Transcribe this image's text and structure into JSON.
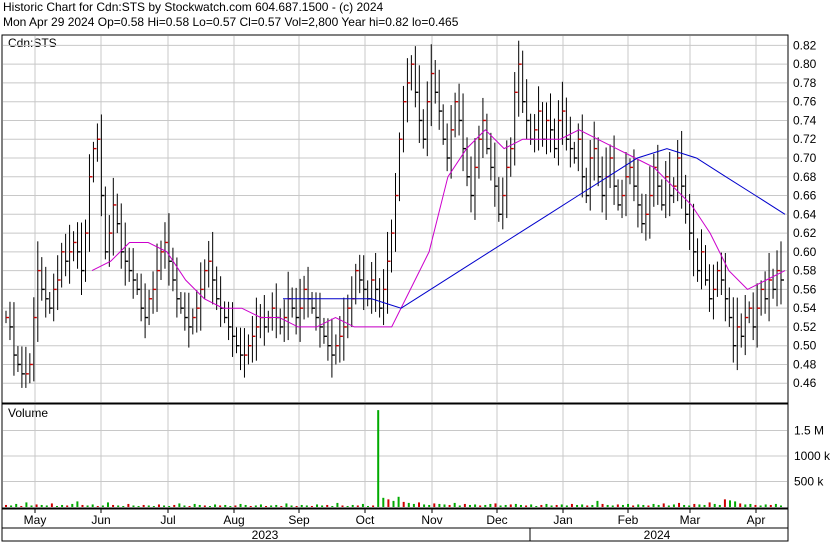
{
  "header": {
    "line1": "Historic Chart for Cdn:STS by Stockwatch.com 604.687.1500 - (c) 2024",
    "line2": "Mon Apr 29 2024  Op=0.58  Hi=0.58  Lo=0.57  Cl=0.57  Vol=2,800  Year hi=0.82  lo=0.465"
  },
  "price_panel": {
    "symbol_label": "Cdn:STS"
  },
  "volume_panel": {
    "label": "Volume"
  },
  "colors": {
    "up_tick": "#cc0000",
    "bar": "#000000",
    "ma_short": "#cc00cc",
    "ma_long": "#0000cc",
    "volume_up": "#00aa00",
    "volume_down": "#cc0000",
    "grid": "#c8c8c8"
  },
  "chart_data": [
    {
      "type": "ohlc",
      "title": "Cdn:STS",
      "ylim": [
        0.44,
        0.83
      ],
      "yticks": [
        "0.82",
        "0.80",
        "0.78",
        "0.76",
        "0.74",
        "0.72",
        "0.70",
        "0.68",
        "0.66",
        "0.64",
        "0.62",
        "0.60",
        "0.58",
        "0.56",
        "0.54",
        "0.52",
        "0.50",
        "0.48",
        "0.46"
      ],
      "xlabels": [
        "May",
        "Jun",
        "Jul",
        "Aug",
        "Sep",
        "Oct",
        "Nov",
        "Dec",
        "Jan",
        "Feb",
        "Mar",
        "Apr"
      ],
      "year_labels": [
        "2023",
        "2024"
      ],
      "grid": true,
      "series": [
        {
          "kind": "close",
          "values": [
            0.53,
            0.52,
            0.49,
            0.48,
            0.47,
            0.47,
            0.48,
            0.53,
            0.58,
            0.56,
            0.55,
            0.54,
            0.56,
            0.57,
            0.6,
            0.59,
            0.6,
            0.61,
            0.6,
            0.58,
            0.62,
            0.68,
            0.71,
            0.72,
            0.66,
            0.6,
            0.62,
            0.65,
            0.63,
            0.6,
            0.59,
            0.58,
            0.57,
            0.56,
            0.54,
            0.53,
            0.55,
            0.56,
            0.58,
            0.6,
            0.61,
            0.59,
            0.57,
            0.55,
            0.54,
            0.53,
            0.52,
            0.53,
            0.54,
            0.56,
            0.58,
            0.59,
            0.57,
            0.55,
            0.54,
            0.53,
            0.52,
            0.51,
            0.5,
            0.49,
            0.49,
            0.5,
            0.51,
            0.52,
            0.53,
            0.52,
            0.53,
            0.54,
            0.53,
            0.52,
            0.53,
            0.55,
            0.54,
            0.53,
            0.54,
            0.56,
            0.55,
            0.54,
            0.53,
            0.52,
            0.51,
            0.5,
            0.49,
            0.5,
            0.51,
            0.52,
            0.54,
            0.55,
            0.58,
            0.57,
            0.56,
            0.55,
            0.57,
            0.56,
            0.54,
            0.56,
            0.59,
            0.62,
            0.66,
            0.72,
            0.76,
            0.78,
            0.8,
            0.77,
            0.74,
            0.72,
            0.76,
            0.79,
            0.77,
            0.75,
            0.72,
            0.7,
            0.73,
            0.76,
            0.74,
            0.71,
            0.68,
            0.66,
            0.69,
            0.72,
            0.74,
            0.71,
            0.69,
            0.67,
            0.64,
            0.66,
            0.69,
            0.71,
            0.77,
            0.8,
            0.76,
            0.74,
            0.72,
            0.73,
            0.75,
            0.72,
            0.74,
            0.73,
            0.71,
            0.74,
            0.75,
            0.72,
            0.71,
            0.7,
            0.72,
            0.68,
            0.66,
            0.7,
            0.71,
            0.68,
            0.66,
            0.68,
            0.7,
            0.67,
            0.65,
            0.66,
            0.68,
            0.69,
            0.67,
            0.65,
            0.63,
            0.64,
            0.66,
            0.69,
            0.67,
            0.65,
            0.68,
            0.66,
            0.67,
            0.7,
            0.67,
            0.64,
            0.62,
            0.6,
            0.58,
            0.6,
            0.57,
            0.55,
            0.56,
            0.58,
            0.57,
            0.55,
            0.53,
            0.5,
            0.52,
            0.51,
            0.53,
            0.54,
            0.52,
            0.54,
            0.56,
            0.55,
            0.57,
            0.56,
            0.58,
            0.57
          ],
          "note": "daily closes, May 2023 to Apr 29 2024"
        }
      ],
      "moving_averages": [
        {
          "label": "short MA (magenta)",
          "values": [
            0.58,
            0.59,
            0.61,
            0.61,
            0.6,
            0.57,
            0.55,
            0.54,
            0.54,
            0.53,
            0.53,
            0.52,
            0.52,
            0.53,
            0.52,
            0.52,
            0.52,
            0.56,
            0.6,
            0.68,
            0.71,
            0.73,
            0.71,
            0.72,
            0.72,
            0.72,
            0.73,
            0.72,
            0.71,
            0.7,
            0.69,
            0.67,
            0.65,
            0.62,
            0.58,
            0.56,
            0.57,
            0.58
          ]
        },
        {
          "label": "long MA (blue)",
          "values": [
            0.55,
            0.55,
            0.55,
            0.55,
            0.54,
            0.56,
            0.58,
            0.6,
            0.62,
            0.64,
            0.66,
            0.68,
            0.7,
            0.71,
            0.7,
            0.68,
            0.66,
            0.64
          ]
        }
      ]
    },
    {
      "type": "bar",
      "title": "Volume",
      "yticks": [
        "1.5 M",
        "1000 k",
        "500 k"
      ],
      "ylim": [
        0,
        2000000
      ],
      "values": [
        40000,
        30000,
        60000,
        20000,
        90000,
        30000,
        50000,
        40000,
        30000,
        70000,
        20000,
        40000,
        30000,
        60000,
        110000,
        40000,
        30000,
        50000,
        20000,
        30000,
        90000,
        40000,
        30000,
        20000,
        60000,
        30000,
        20000,
        40000,
        30000,
        20000,
        50000,
        30000,
        20000,
        40000,
        70000,
        30000,
        20000,
        60000,
        40000,
        30000,
        20000,
        50000,
        30000,
        40000,
        20000,
        30000,
        60000,
        40000,
        20000,
        30000,
        50000,
        20000,
        30000,
        40000,
        20000,
        70000,
        30000,
        20000,
        40000,
        30000,
        20000,
        50000,
        30000,
        40000,
        20000,
        80000,
        30000,
        20000,
        40000,
        30000,
        60000,
        20000,
        30000,
        1900000,
        180000,
        150000,
        120000,
        200000,
        100000,
        80000,
        60000,
        90000,
        50000,
        40000,
        70000,
        60000,
        50000,
        40000,
        80000,
        30000,
        60000,
        40000,
        50000,
        30000,
        40000,
        60000,
        70000,
        30000,
        40000,
        50000,
        60000,
        40000,
        30000,
        50000,
        20000,
        40000,
        60000,
        30000,
        40000,
        50000,
        30000,
        60000,
        40000,
        50000,
        30000,
        40000,
        120000,
        60000,
        40000,
        30000,
        50000,
        40000,
        60000,
        30000,
        50000,
        40000,
        30000,
        60000,
        40000,
        70000,
        30000,
        50000,
        80000,
        40000,
        30000,
        60000,
        50000,
        40000,
        90000,
        60000,
        40000,
        150000,
        130000,
        110000,
        70000,
        50000,
        60000,
        40000,
        30000,
        50000,
        40000,
        60000,
        30000
      ]
    }
  ]
}
